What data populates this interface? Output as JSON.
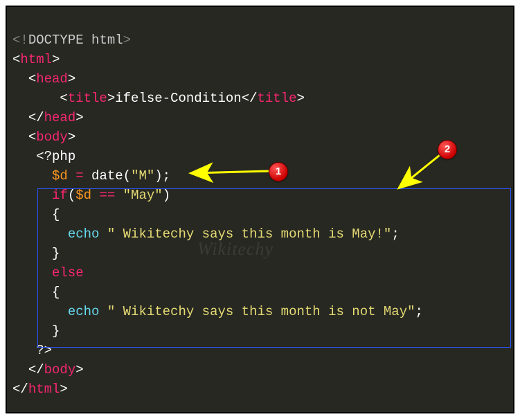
{
  "code": {
    "l1": {
      "a": "<!",
      "b": "DOCTYPE",
      "c": " ",
      "d": "html",
      "e": ">"
    },
    "l2": {
      "a": "<",
      "b": "html",
      "c": ">"
    },
    "l3": {
      "a": "<",
      "b": "head",
      "c": ">"
    },
    "l4": {
      "a": "<",
      "b": "title",
      "c": ">",
      "d": "ifelse-Condition",
      "e": "</",
      "f": "title",
      "g": ">"
    },
    "l5": {
      "a": "</",
      "b": "head",
      "c": ">"
    },
    "l6": {
      "a": "<",
      "b": "body",
      "c": ">"
    },
    "l7": {
      "a": "<?",
      "b": "php"
    },
    "l8": {
      "a": "$d",
      "b": " ",
      "c": "=",
      "d": " date(",
      "e": "\"M\"",
      "f": ");"
    },
    "l9": {
      "a": "if",
      "b": "(",
      "c": "$d",
      "d": " ",
      "e": "==",
      "f": " ",
      "g": "\"May\"",
      "h": ")"
    },
    "l10": {
      "a": "{"
    },
    "l11": {
      "a": "echo",
      "b": " ",
      "c": "\" Wikitechy says this month is May!\"",
      "d": ";"
    },
    "l12": {
      "a": "}"
    },
    "l13": {
      "a": "else"
    },
    "l14": {
      "a": "{"
    },
    "l15": {
      "a": "echo",
      "b": " ",
      "c": "\" Wikitechy says this month is not May\"",
      "d": ";"
    },
    "l16": {
      "a": "}"
    },
    "l17": {
      "a": "?>"
    },
    "l18": {
      "a": "</",
      "b": "body",
      "c": ">"
    },
    "l19": {
      "a": "</",
      "b": "html",
      "c": ">"
    }
  },
  "badges": {
    "b1": "1",
    "b2": "2"
  },
  "watermark": "Wikitechy"
}
